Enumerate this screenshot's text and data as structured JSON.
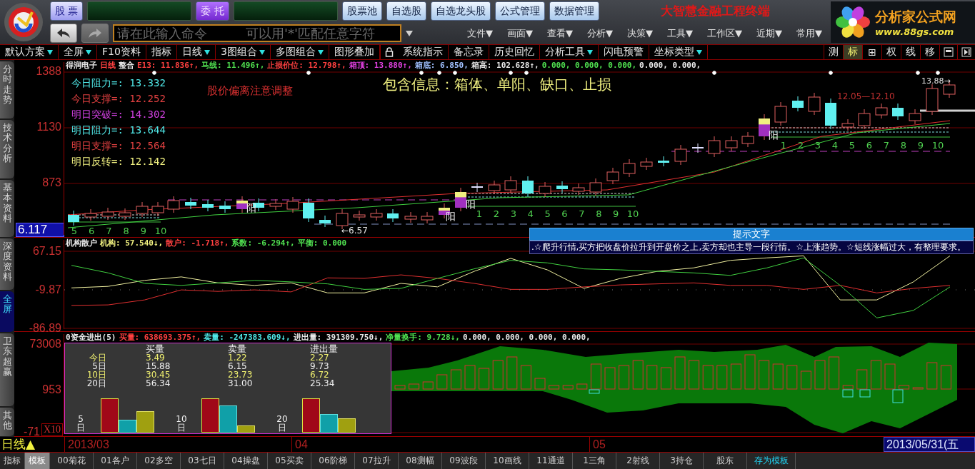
{
  "header": {
    "buttons": [
      {
        "label": "股 票",
        "kind": "primary"
      },
      {
        "label": "委 托",
        "kind": "accent"
      },
      {
        "label": "股票池",
        "kind": "plain"
      },
      {
        "label": "自选股",
        "kind": "plain"
      },
      {
        "label": "自选龙头股",
        "kind": "plain"
      },
      {
        "label": "公式管理",
        "kind": "plain"
      },
      {
        "label": "数据管理",
        "kind": "plain"
      }
    ],
    "title": "大智慧金融工程终端",
    "nav": [
      {
        "kind": "back",
        "disabled": false
      },
      {
        "kind": "forward",
        "disabled": true
      }
    ],
    "command": {
      "placeholder": "请在此输入命令　　　可以用'*'匹配任意字符"
    },
    "menus": [
      "文件▼",
      "画面▼",
      "查看▼",
      "分析▼",
      "决策▼",
      "工具▼",
      "工作区▼",
      "近期▼",
      "常用▼"
    ],
    "brand": {
      "name": "分析家公式网",
      "url": "www.88gs.com"
    }
  },
  "toolbar": {
    "items": [
      {
        "kind": "text",
        "label": "默认方案",
        "dropdown": true
      },
      {
        "kind": "text",
        "label": "全屏",
        "dropdown": true
      },
      {
        "kind": "text",
        "label": "F10资料",
        "dropdown": false
      },
      {
        "kind": "text",
        "label": "指标",
        "dropdown": false
      },
      {
        "kind": "text",
        "label": "日线",
        "dropdown": true
      },
      {
        "kind": "text",
        "label": "3图组合",
        "dropdown": true
      },
      {
        "kind": "text",
        "label": "多图组合",
        "dropdown": true
      },
      {
        "kind": "text",
        "label": "图形叠加",
        "dropdown": false
      },
      {
        "kind": "lock"
      },
      {
        "kind": "text",
        "label": "系统指示",
        "dropdown": false
      },
      {
        "kind": "text",
        "label": "备忘录",
        "dropdown": false
      },
      {
        "kind": "text",
        "label": "历史回忆",
        "dropdown": false
      },
      {
        "kind": "text",
        "label": "分析工具",
        "dropdown": true
      },
      {
        "kind": "text",
        "label": "闪电预警",
        "dropdown": false
      },
      {
        "kind": "text",
        "label": "坐标类型",
        "dropdown": true
      }
    ],
    "tools": [
      {
        "label": "测",
        "selected": false
      },
      {
        "label": "标",
        "selected": true
      },
      {
        "label": "⊞",
        "selected": false
      },
      {
        "label": "权",
        "selected": false
      },
      {
        "label": "线",
        "selected": false
      },
      {
        "label": "移",
        "selected": false
      }
    ]
  },
  "side_tabs": [
    {
      "label": "分时走势",
      "selected": false
    },
    {
      "label": "技术分析",
      "selected": false
    },
    {
      "label": "基本资料",
      "selected": false
    },
    {
      "label": "深度资料",
      "selected": false
    },
    {
      "label": "全屏",
      "selected": true
    },
    {
      "label": "卫东超赢",
      "selected": false
    },
    {
      "label": "其他",
      "selected": false
    }
  ],
  "price_panel": {
    "info": [
      {
        "text": "得润电子",
        "color": "#e8e8e8"
      },
      {
        "text": "日线",
        "color": "#ff4040"
      },
      {
        "text": "整合",
        "color": "#e8e8e8"
      },
      {
        "text": "E13: 11.836↑,",
        "color": "#ff4040"
      },
      {
        "text": "马线: 11.496↑,",
        "color": "#50e050"
      },
      {
        "text": "止损价位: 12.798↑,",
        "color": "#ff4040"
      },
      {
        "text": "箱顶: 13.880↑,",
        "color": "#e040e0"
      },
      {
        "text": "箱底: 6.850,",
        "color": "#a0c0ff"
      },
      {
        "text": "箱高: 102.628↑,",
        "color": "#e8e8e8"
      },
      {
        "text": "0.000, 0.000, 0.000,",
        "color": "#50e050"
      },
      {
        "text": "0.000, 0.000,",
        "color": "#e8e8e8"
      }
    ],
    "axis_labels": [
      "1388",
      "1130",
      "873"
    ],
    "current_price": "6.117",
    "levels": [
      {
        "text": "今日阻力=: 13.332",
        "color": "#50e8e8"
      },
      {
        "text": "今日支撑=: 12.252",
        "color": "#e04040"
      },
      {
        "text": "明日突破=: 14.302",
        "color": "#d040e0"
      },
      {
        "text": "明日阻力=: 13.644",
        "color": "#50e8e8"
      },
      {
        "text": "明日支撑=: 12.564",
        "color": "#e04040"
      },
      {
        "text": "明日反转=: 12.142",
        "color": "#f0f080"
      }
    ],
    "note": "股价偏离注意调整",
    "headline": "包含信息：箱体、单阳、缺口、止损",
    "count_rows": [
      [
        "5",
        "6",
        "7",
        "8",
        "9",
        "10"
      ],
      [
        "1",
        "2",
        "3",
        "4",
        "5",
        "6",
        "7",
        "8",
        "9",
        "10"
      ],
      [
        "1",
        "2",
        "3",
        "4",
        "5",
        "6",
        "7",
        "8",
        "9",
        "10"
      ]
    ],
    "yang_marks": [
      "阳",
      "阳",
      "阳",
      "阳"
    ],
    "low_mark": "←6.57",
    "high_mark": "13.88→",
    "range_mark": "12.05—12.10",
    "hint": {
      "title": "提示文字",
      "text": ".☆爬升行情,买方把收盘价拉升到开盘价之上,卖方却也主导一段行情。☆上涨趋势。☆短线涨幅过大，有整理要求。"
    }
  },
  "flow_panel": {
    "info": [
      {
        "text": "机构散户",
        "color": "#e8e8e8"
      },
      {
        "text": "机构: 57.540↓,",
        "color": "#f0f080"
      },
      {
        "text": "散户: -1.718↑,",
        "color": "#ff4040"
      },
      {
        "text": "系数: -6.294↑,",
        "color": "#50e050"
      },
      {
        "text": "平衡: 0.000",
        "color": "#50e050"
      }
    ],
    "chart_data": {
      "type": "line",
      "ylim": [
        -86.89,
        67.15
      ],
      "ref_lines": [
        {
          "axis": "y",
          "value": -9.87
        }
      ],
      "yticks": [
        {
          "value": 67.15,
          "label": "67.15"
        },
        {
          "value": -9.87,
          "label": "-9.87"
        },
        {
          "value": -86.89,
          "label": "-86.89"
        }
      ],
      "series": [
        {
          "color": "#f0f0a0",
          "values": [
            -6,
            -3,
            9,
            16,
            4,
            -1,
            4,
            -16,
            -16,
            3,
            -4,
            27,
            53,
            30,
            -7,
            13,
            27,
            34,
            49,
            54,
            58,
            -30,
            -30,
            6,
            58
          ]
        },
        {
          "color": "#e03030",
          "values": [
            -41,
            -40,
            -30,
            -10,
            -13,
            -10,
            -14,
            14,
            13,
            20,
            13,
            3,
            -9,
            -9,
            -4,
            0,
            2,
            4,
            -1,
            -1,
            -9,
            -1,
            -16,
            -7,
            -1
          ]
        },
        {
          "color": "#40d040",
          "values": [
            39,
            24,
            3,
            -1,
            4,
            9,
            6,
            2,
            -9,
            -7,
            13,
            32,
            49,
            44,
            32,
            30,
            27,
            24,
            19,
            34,
            54,
            -1,
            -66,
            -51,
            -4
          ]
        }
      ]
    }
  },
  "fund_panel": {
    "info": [
      {
        "text": "0资金进出(5)",
        "color": "#e8e8e8"
      },
      {
        "text": "买量: 638693.375↑,",
        "color": "#ff4040"
      },
      {
        "text": "卖量: -247383.609↓,",
        "color": "#50e8e8"
      },
      {
        "text": "进出量: 391309.750↓,",
        "color": "#e8e8e8"
      },
      {
        "text": "净量换手: 9.728↓,",
        "color": "#50e050"
      },
      {
        "text": "0.000, 0.000, 0.000, 0.000,",
        "color": "#e8e8e8"
      }
    ],
    "axis_labels": [
      "73008",
      "953",
      "-71"
    ],
    "scale_tag": "X10",
    "table": {
      "columns": [
        "买量",
        "卖量",
        "进出量"
      ],
      "rows": [
        {
          "label": "今日",
          "cells": [
            "3.49",
            "1.22",
            "2.27"
          ],
          "color": "#f0f070"
        },
        {
          "label": "5日",
          "cells": [
            "15.88",
            "6.15",
            "9.73"
          ],
          "color": "#f0f0f0"
        },
        {
          "label": "10日",
          "cells": [
            "30.45",
            "23.73",
            "6.72"
          ],
          "color": "#f0f070"
        },
        {
          "label": "20日",
          "cells": [
            "56.34",
            "31.00",
            "25.34"
          ],
          "color": "#f0f0f0"
        }
      ]
    },
    "bar_groups": [
      "5日",
      "10日",
      "20日"
    ]
  },
  "date_axis": {
    "period": "日线▲",
    "months": [
      "2013/03",
      "04",
      "05"
    ],
    "end_date": "2013/05/31(五"
  },
  "bottom_tabs": [
    {
      "label": "指标",
      "kind": "tab",
      "selected": false
    },
    {
      "label": "模板",
      "kind": "tab",
      "selected": true
    },
    {
      "label": "00菊花",
      "kind": "tab",
      "selected": false
    },
    {
      "label": "01各户",
      "kind": "tab",
      "selected": false
    },
    {
      "label": "02多空",
      "kind": "tab",
      "selected": false
    },
    {
      "label": "03七日",
      "kind": "tab",
      "selected": false
    },
    {
      "label": "04操盘",
      "kind": "tab",
      "selected": false
    },
    {
      "label": "05买卖",
      "kind": "tab",
      "selected": false
    },
    {
      "label": "06阶梯",
      "kind": "tab",
      "selected": false
    },
    {
      "label": "07拉升",
      "kind": "tab",
      "selected": false
    },
    {
      "label": "08测幅",
      "kind": "tab",
      "selected": false
    },
    {
      "label": "09波段",
      "kind": "tab",
      "selected": false
    },
    {
      "label": "10画线",
      "kind": "tab",
      "selected": false
    },
    {
      "label": "11通道",
      "kind": "tab",
      "selected": false
    },
    {
      "label": "1三角",
      "kind": "tab",
      "selected": false
    },
    {
      "label": "2射线",
      "kind": "tab",
      "selected": false
    },
    {
      "label": "3持仓",
      "kind": "tab",
      "selected": false
    },
    {
      "label": "股东",
      "kind": "tab",
      "selected": false
    },
    {
      "label": "存为模板",
      "kind": "action",
      "selected": false
    }
  ]
}
